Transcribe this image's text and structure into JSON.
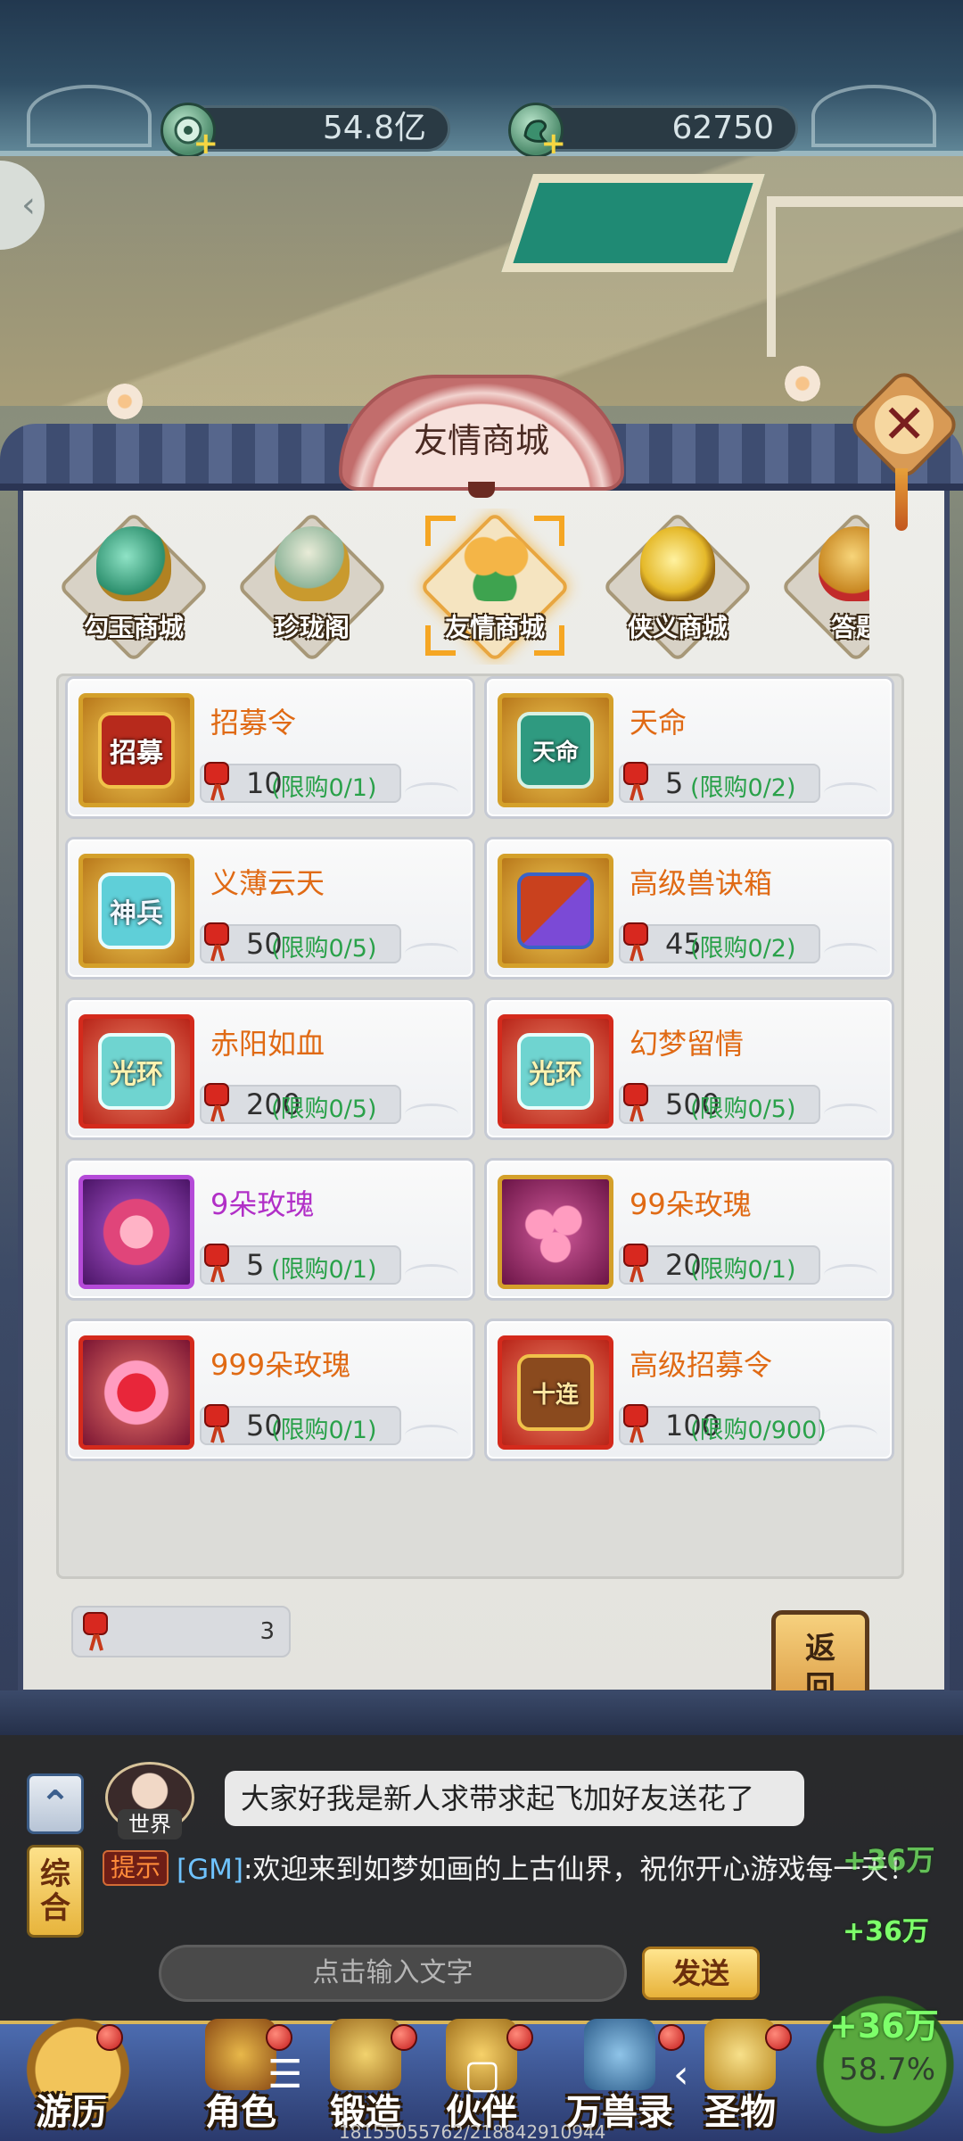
{
  "currency": {
    "gold": "54.8亿",
    "jade": "62750"
  },
  "shop": {
    "title": "友情商城",
    "tabs": [
      {
        "label": "勾玉商城",
        "active": false
      },
      {
        "label": "珍珑阁",
        "active": false
      },
      {
        "label": "友情商城",
        "active": true
      },
      {
        "label": "侠义商城",
        "active": false
      },
      {
        "label": "答题",
        "active": false
      }
    ],
    "items": [
      {
        "name": "招募令",
        "price": "10",
        "limit": "(限购0/1)"
      },
      {
        "name": "天命",
        "price": "5",
        "limit": "(限购0/2)"
      },
      {
        "name": "义薄云天",
        "price": "50",
        "limit": "(限购0/5)"
      },
      {
        "name": "高级兽诀箱",
        "price": "45",
        "limit": "(限购0/2)"
      },
      {
        "name": "赤阳如血",
        "price": "200",
        "limit": "(限购0/5)"
      },
      {
        "name": "幻梦留情",
        "price": "500",
        "limit": "(限购0/5)"
      },
      {
        "name": "9朵玫瑰",
        "price": "5",
        "limit": "(限购0/1)"
      },
      {
        "name": "99朵玫瑰",
        "price": "20",
        "limit": "(限购0/1)"
      },
      {
        "name": "999朵玫瑰",
        "price": "50",
        "limit": "(限购0/1)"
      },
      {
        "name": "高级招募令",
        "price": "100",
        "limit": "(限购0/900)"
      }
    ],
    "icon_text": {
      "recruit": "招募",
      "fate": "天命",
      "weapon": "神兵",
      "halo": "光环",
      "adv_recruit": "十连"
    },
    "balance": "3",
    "back_label_1": "返",
    "back_label_2": "回"
  },
  "chat": {
    "up_icon": "⌃",
    "mix_label_1": "综",
    "mix_label_2": "合",
    "world_tag": "世界",
    "player_msg": "大家好我是新人求带求起飞加好友送花了",
    "sys_tag": "提示",
    "gm_tag": "[GM]",
    "sys_msg": ":欢迎来到如梦如画的上古仙界，祝你开心游戏每一天！",
    "float_1": "+36万",
    "float_2": "+36万",
    "input_placeholder": "点击输入文字",
    "send_label": "发送"
  },
  "nav": {
    "items": [
      "游历",
      "角色",
      "锻造",
      "伙伴",
      "万兽录",
      "圣物"
    ],
    "exp_gain": "+36万",
    "exp_percent": "58.7%",
    "uid": "18155055762/218842910944"
  },
  "colors": {
    "item_name": "#e06a14",
    "item_name_epic": "#b12fc7",
    "limit_text": "#2aa14a",
    "gm_text": "#6fc3ff",
    "exp_float": "#7dff6a"
  }
}
